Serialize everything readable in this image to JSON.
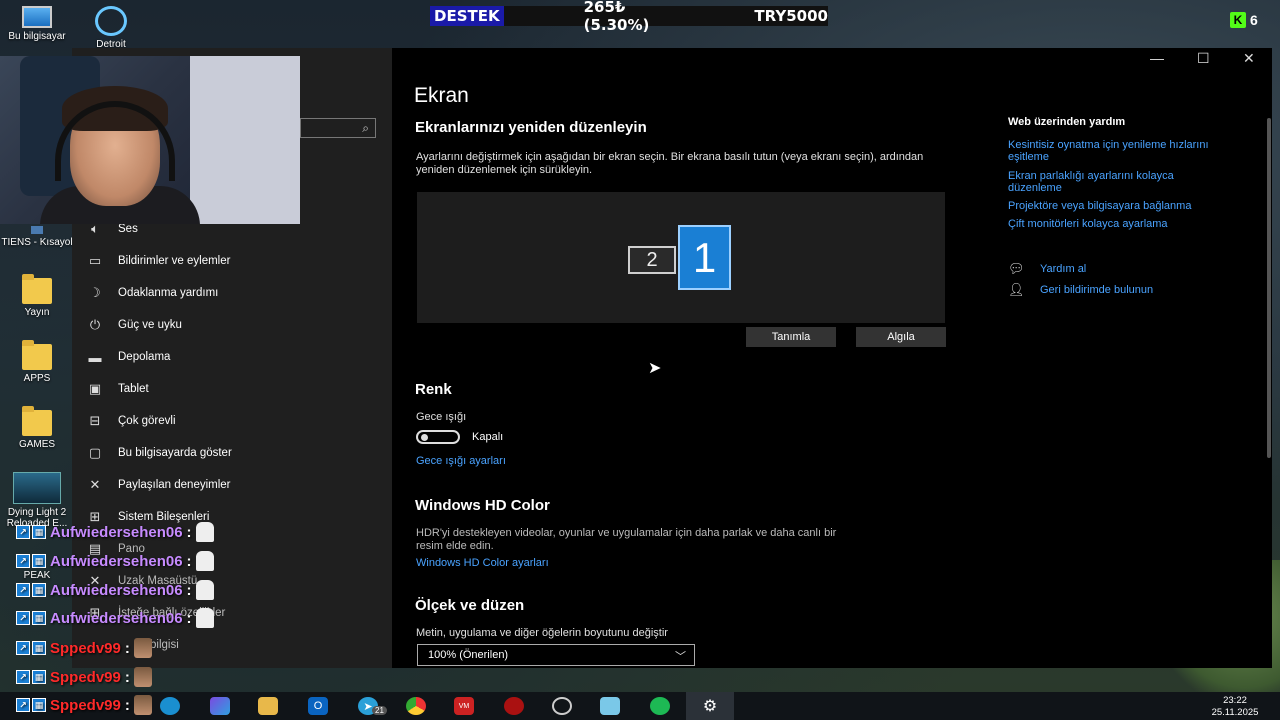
{
  "desktop": {
    "icons": [
      {
        "label": "Bu bilgisayar"
      },
      {
        "label": "Detroit"
      },
      {
        "label": "TIENS - Kısayol"
      },
      {
        "label": "Yayın"
      },
      {
        "label": "APPS"
      },
      {
        "label": "GAMES"
      },
      {
        "label": "Dying Light 2 Reloaded E..."
      },
      {
        "label": "PEAK"
      }
    ]
  },
  "ticker": {
    "label": "DESTEK",
    "amount": "265₺ (5.30%)",
    "goal": "TRY5000"
  },
  "kick": {
    "count": "6"
  },
  "sidebar": {
    "items": [
      {
        "label": "Ses",
        "icon": "speaker-icon"
      },
      {
        "label": "Bildirimler ve eylemler",
        "icon": "notification-icon"
      },
      {
        "label": "Odaklanma yardımı",
        "icon": "moon-icon"
      },
      {
        "label": "Güç ve uyku",
        "icon": "power-icon"
      },
      {
        "label": "Depolama",
        "icon": "storage-icon"
      },
      {
        "label": "Tablet",
        "icon": "tablet-icon"
      },
      {
        "label": "Çok görevli",
        "icon": "multitask-icon"
      },
      {
        "label": "Bu bilgisayarda göster",
        "icon": "project-icon"
      },
      {
        "label": "Paylaşılan deneyimler",
        "icon": "shared-icon"
      },
      {
        "label": "Sistem Bileşenleri",
        "icon": "components-icon"
      },
      {
        "label": "Pano",
        "icon": "clipboard-icon"
      },
      {
        "label": "Uzak Masaüstü",
        "icon": "remote-icon"
      },
      {
        "label": "İsteğe bağlı özellikler",
        "icon": "optional-icon"
      },
      {
        "label": "bilgisi",
        "icon": "info-icon"
      }
    ]
  },
  "main": {
    "title": "Ekran",
    "rearrange": {
      "heading": "Ekranlarınızı yeniden düzenleyin",
      "desc": "Ayarlarını değiştirmek için aşağıdan bir ekran seçin. Bir ekrana basılı tutun (veya ekranı seçin), ardından yeniden düzenlemek için sürükleyin.",
      "monitor1": "1",
      "monitor2": "2",
      "identify": "Tanımla",
      "detect": "Algıla"
    },
    "color": {
      "heading": "Renk",
      "night_light": "Gece ışığı",
      "toggle_state": "Kapalı",
      "night_settings": "Gece ışığı ayarları"
    },
    "hd": {
      "heading": "Windows HD Color",
      "desc": "HDR'yi destekleyen videolar, oyunlar ve uygulamalar için daha parlak ve daha canlı bir resim elde edin.",
      "link": "Windows HD Color ayarları"
    },
    "scale": {
      "heading": "Ölçek ve düzen",
      "label": "Metin, uygulama ve diğer öğelerin boyutunu değiştir",
      "value": "100% (Önerilen)"
    }
  },
  "help": {
    "heading": "Web üzerinden yardım",
    "links": [
      "Kesintisiz oynatma için yenileme hızlarını eşitleme",
      "Ekran parlaklığı ayarlarını kolayca düzenleme",
      "Projektöre veya bilgisayara bağlanma",
      "Çift monitörleri kolayca ayarlama"
    ],
    "get_help": "Yardım al",
    "feedback": "Geri bildirimde bulunun"
  },
  "chat": [
    {
      "user": "Aufwiedersehen06",
      "sep": ":"
    },
    {
      "user": "Aufwiedersehen06",
      "sep": ":"
    },
    {
      "user": "Aufwiedersehen06",
      "sep": ":"
    },
    {
      "user": "Aufwiedersehen06",
      "sep": ":"
    },
    {
      "user": "Sppedv99",
      "sep": ":"
    },
    {
      "user": "Sppedv99",
      "sep": ":"
    },
    {
      "user": "Sppedv99",
      "sep": ":"
    }
  ],
  "taskbar": {
    "telegram_badge": "21",
    "time": "23:22",
    "date": "25.11.2025"
  },
  "colors": {
    "accent": "#1a7fd4",
    "link": "#4aa3ff",
    "chat_purple": "#c78bff",
    "chat_red": "#ff2a2a"
  }
}
